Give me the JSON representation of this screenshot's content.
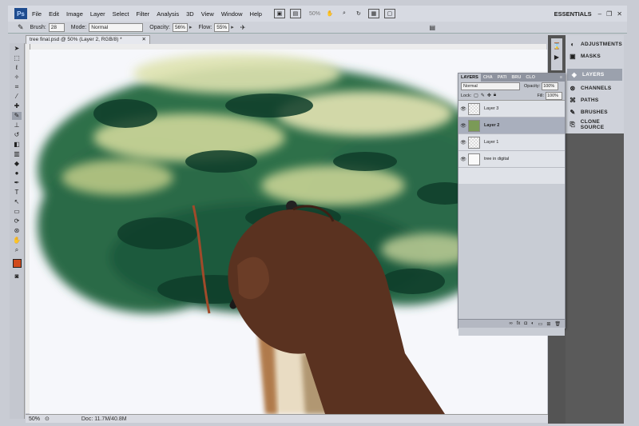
{
  "app": {
    "logo": "Ps",
    "workspace": "ESSENTIALS"
  },
  "menu": [
    "File",
    "Edit",
    "Image",
    "Layer",
    "Select",
    "Filter",
    "Analysis",
    "3D",
    "View",
    "Window",
    "Help"
  ],
  "menubar": {
    "zoom": "50%"
  },
  "options": {
    "brush_label": "Brush:",
    "brush_size": "28",
    "mode_label": "Mode:",
    "mode_value": "Normal",
    "opacity_label": "Opacity:",
    "opacity_value": "56%",
    "flow_label": "Flow:",
    "flow_value": "55%"
  },
  "document": {
    "tab_title": "tree final.psd @ 50% (Layer 2, RGB/8) *",
    "status_zoom": "50%",
    "status_doc": "Doc: 11.7M/40.8M"
  },
  "panel_list": [
    "ADJUSTMENTS",
    "MASKS",
    "LAYERS",
    "CHANNELS",
    "PATHS",
    "BRUSHES",
    "CLONE SOURCE"
  ],
  "layers_panel": {
    "tabs": [
      "LAYERS",
      "CHA",
      "PATI",
      "BRU",
      "CLO"
    ],
    "blend_mode": "Normal",
    "opacity_label": "Opacity:",
    "opacity_value": "100%",
    "lock_label": "Lock:",
    "fill_label": "Fill:",
    "fill_value": "100%",
    "layers": [
      {
        "name": "Layer 3",
        "selected": false
      },
      {
        "name": "Layer 2",
        "selected": true
      },
      {
        "name": "Layer 1",
        "selected": false
      },
      {
        "name": "tree in digital",
        "selected": false
      }
    ],
    "footer_icons": [
      "link-icon",
      "fx-icon",
      "mask-icon",
      "adjustment-icon",
      "group-icon",
      "new-layer-icon",
      "trash-icon"
    ]
  },
  "colors": {
    "foreground": "#d04a1c",
    "panel_bg": "#c2c6cf",
    "dock_dark": "#545454",
    "selected_row": "#a9afbd"
  }
}
